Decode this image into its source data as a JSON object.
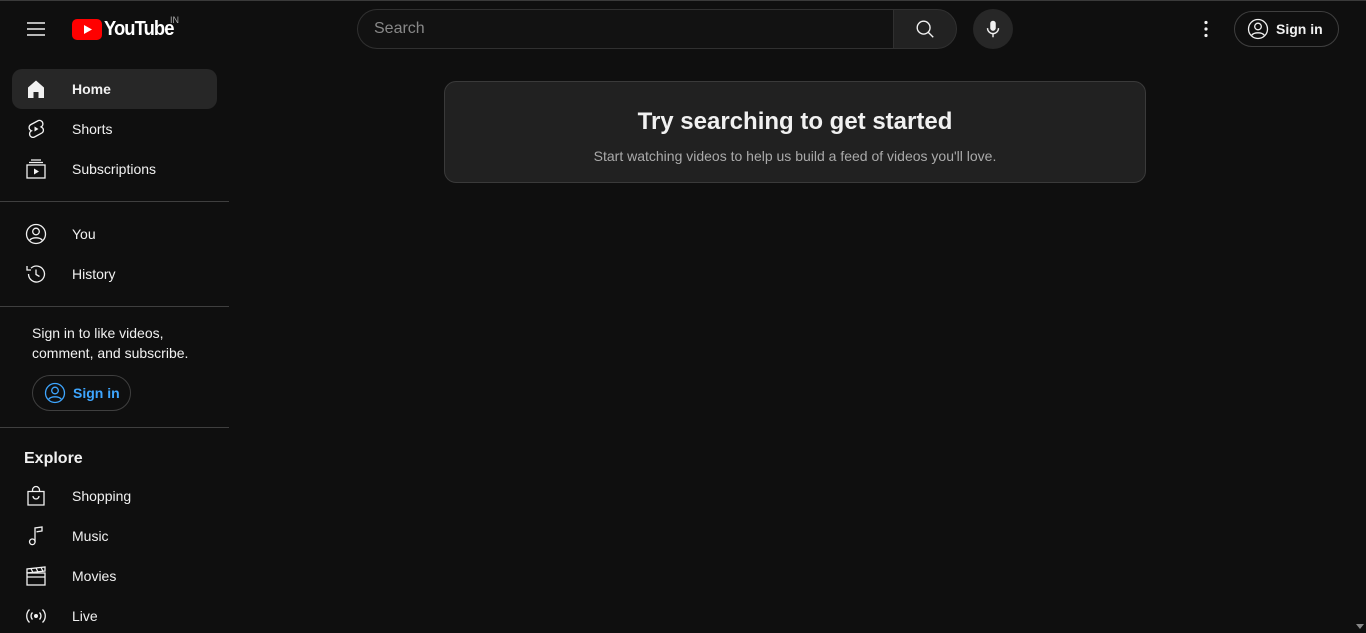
{
  "masthead": {
    "logo_text": "YouTube",
    "country_code": "IN",
    "search_placeholder": "Search",
    "signin_label": "Sign in",
    "brand_red": "#ff0000"
  },
  "sidebar": {
    "primary": [
      {
        "label": "Home",
        "icon": "home-icon",
        "active": true
      },
      {
        "label": "Shorts",
        "icon": "shorts-icon"
      },
      {
        "label": "Subscriptions",
        "icon": "subscriptions-icon"
      }
    ],
    "you": [
      {
        "label": "You",
        "icon": "account-icon"
      },
      {
        "label": "History",
        "icon": "history-icon"
      }
    ],
    "signin_promo": {
      "text": "Sign in to like videos, comment, and subscribe.",
      "button_label": "Sign in",
      "button_color": "#3ea6ff"
    },
    "explore": {
      "title": "Explore",
      "items": [
        {
          "label": "Shopping",
          "icon": "shopping-bag-icon"
        },
        {
          "label": "Music",
          "icon": "music-note-icon"
        },
        {
          "label": "Movies",
          "icon": "clapperboard-icon"
        },
        {
          "label": "Live",
          "icon": "live-broadcast-icon"
        }
      ]
    }
  },
  "main": {
    "prompt_title": "Try searching to get started",
    "prompt_subtitle": "Start watching videos to help us build a feed of videos you'll love."
  }
}
